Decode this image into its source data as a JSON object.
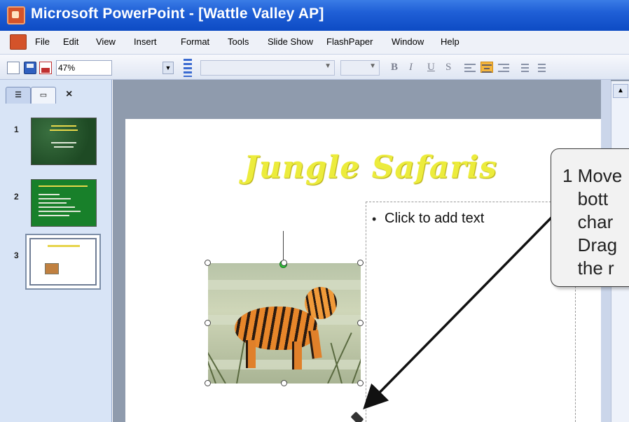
{
  "window": {
    "title": "Microsoft PowerPoint - [Wattle Valley AP]"
  },
  "menu": {
    "items": [
      "File",
      "Edit",
      "View",
      "Insert",
      "Format",
      "Tools",
      "Slide Show",
      "FlashPaper",
      "Window",
      "Help"
    ]
  },
  "toolbar": {
    "zoom": "47%",
    "font_name": "",
    "font_size": "",
    "bold_label": "B",
    "italic_label": "I",
    "underline_label": "U",
    "shadow_label": "S"
  },
  "left_pane": {
    "close_label": "×",
    "thumbnails": [
      {
        "number": "1"
      },
      {
        "number": "2"
      },
      {
        "number": "3"
      }
    ]
  },
  "slide": {
    "title": "Jungle Safaris",
    "placeholder_bullet": "•",
    "placeholder_text": "Click to add text"
  },
  "callout": {
    "text": "1 Move\n   bott\n   char\n   Drag\n   the r"
  },
  "colors": {
    "title_bar": "#0d4bc4",
    "slide_title": "#ecec3c",
    "rotation_handle": "#2fc23a",
    "align_center_active": "#f5b63d"
  },
  "icons": [
    "powerpoint-app-icon",
    "new-document-icon",
    "save-icon",
    "pdf-icon",
    "chevron-down-icon",
    "close-icon",
    "outline-tab-icon",
    "slides-tab-icon",
    "resize-cursor-icon",
    "scroll-up-icon"
  ]
}
